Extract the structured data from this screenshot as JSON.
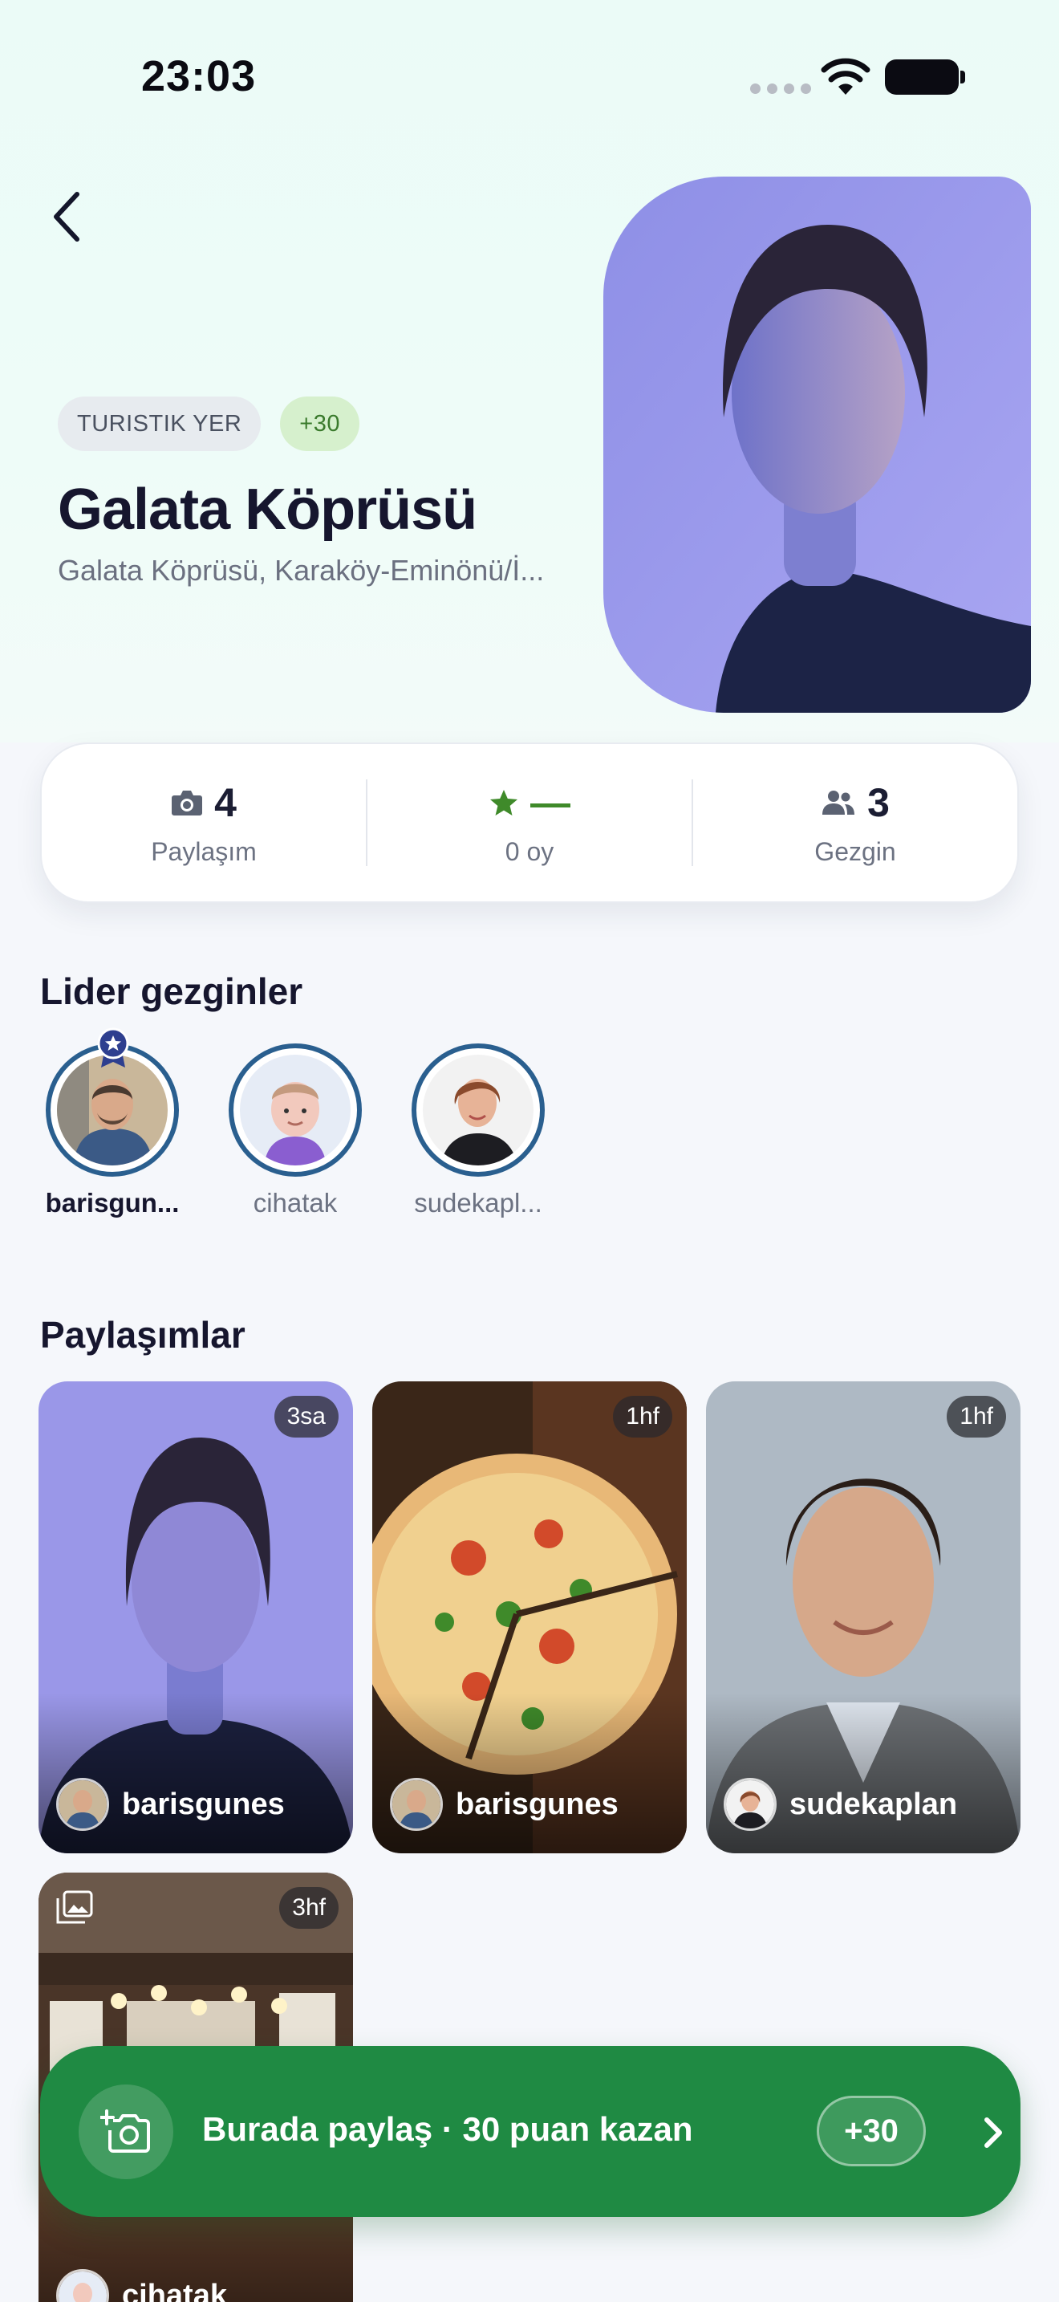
{
  "status_bar": {
    "time": "23:03"
  },
  "place": {
    "category_chip": "TURISTIK YER",
    "points_chip": "+30",
    "title": "Galata Köprüsü",
    "address": "Galata Köprüsü, Karaköy-Eminönü/İ..."
  },
  "stats": [
    {
      "icon": "camera-icon",
      "value": "4",
      "label": "Paylaşım"
    },
    {
      "icon": "star-icon",
      "value": "—",
      "label": "0 oy"
    },
    {
      "icon": "people-icon",
      "value": "3",
      "label": "Gezgin"
    }
  ],
  "leaders": {
    "title": "Lider gezginler",
    "items": [
      {
        "name": "barisgun..."
      },
      {
        "name": "cihatak"
      },
      {
        "name": "sudekapl..."
      }
    ]
  },
  "posts": {
    "title": "Paylaşımlar",
    "items": [
      {
        "time": "3sa",
        "user": "barisgunes"
      },
      {
        "time": "1hf",
        "user": "barisgunes"
      },
      {
        "time": "1hf",
        "user": "sudekaplan"
      },
      {
        "time": "3hf",
        "user": "cihatak"
      }
    ]
  },
  "cta": {
    "label": "Burada paylaş · 30 puan kazan",
    "badge": "+30"
  },
  "colors": {
    "accent_green": "#1f8a43",
    "ring_blue": "#2a5f8f",
    "header_mint": "#ebfbf7"
  }
}
